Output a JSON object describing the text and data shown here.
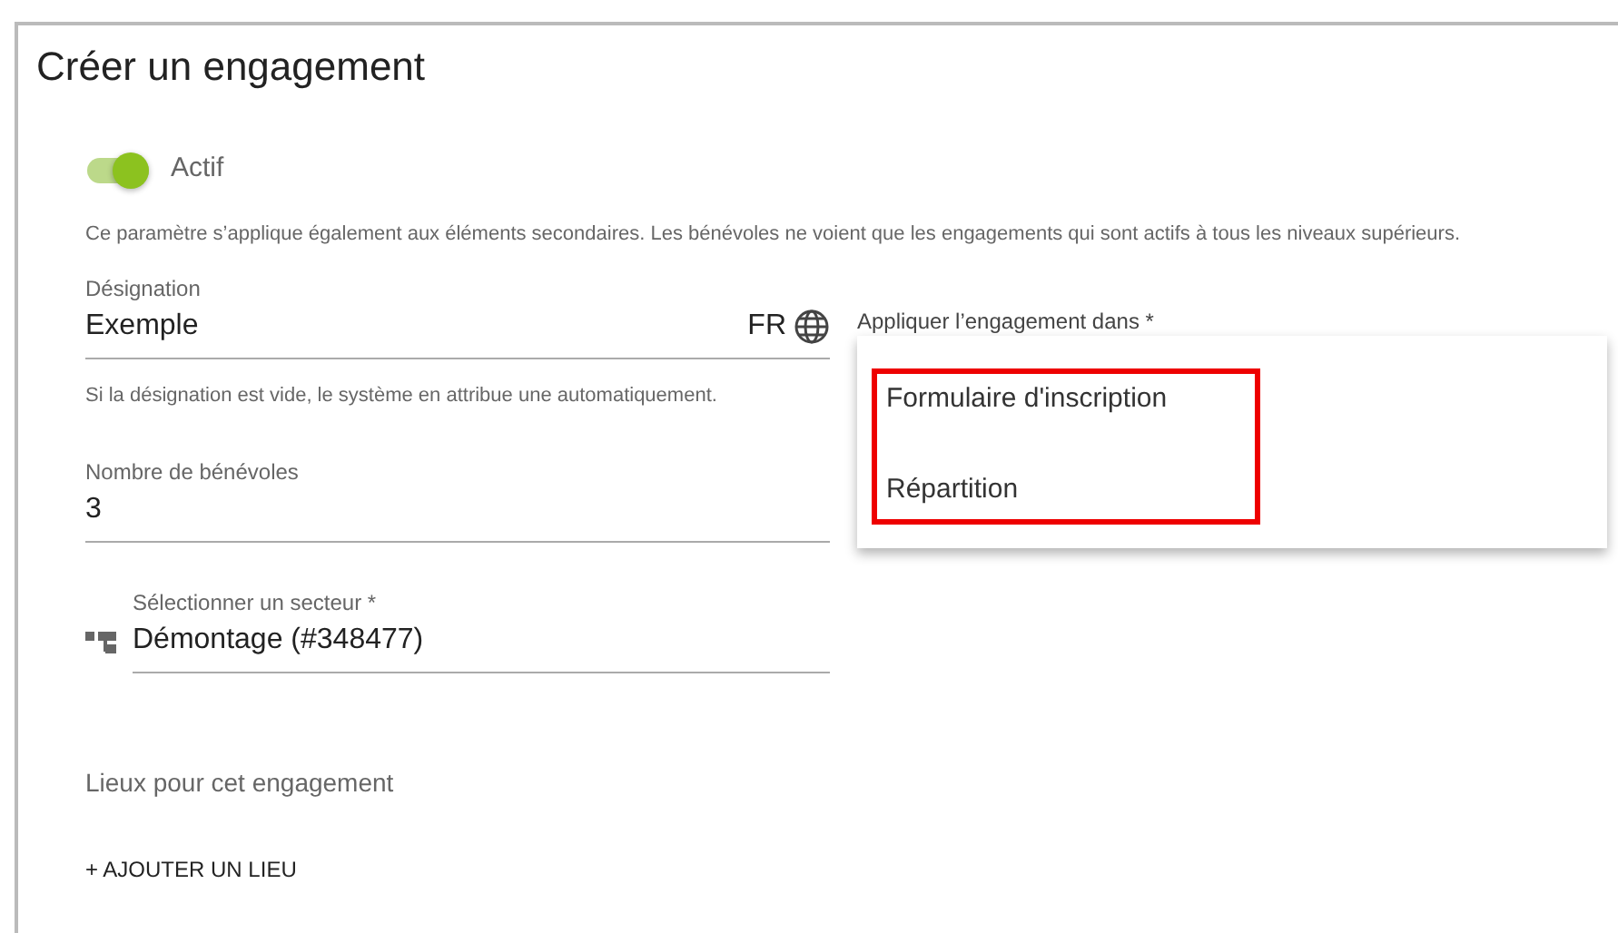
{
  "title": "Créer un engagement",
  "active_toggle": {
    "label": "Actif",
    "on": true
  },
  "active_hint": "Ce paramètre s’applique également aux éléments secondaires. Les bénévoles ne voient que les engagements qui sont actifs à tous les niveaux supérieurs.",
  "designation": {
    "label": "Désignation",
    "value": "Exemple",
    "language": "FR",
    "hint": "Si la désignation est vide, le système en attribue une automatiquement."
  },
  "volunteers": {
    "label": "Nombre de bénévoles",
    "value": "3"
  },
  "sector": {
    "label": "Sélectionner un secteur *",
    "value": "Démontage (#348477)"
  },
  "locations": {
    "label": "Lieux pour cet engagement",
    "add_button": "+ AJOUTER UN LIEU"
  },
  "apply_in": {
    "label": "Appliquer l’engagement dans *",
    "options": [
      {
        "label": "Formulaire d'inscription"
      },
      {
        "label": "Répartition"
      }
    ],
    "highlighted": true
  }
}
